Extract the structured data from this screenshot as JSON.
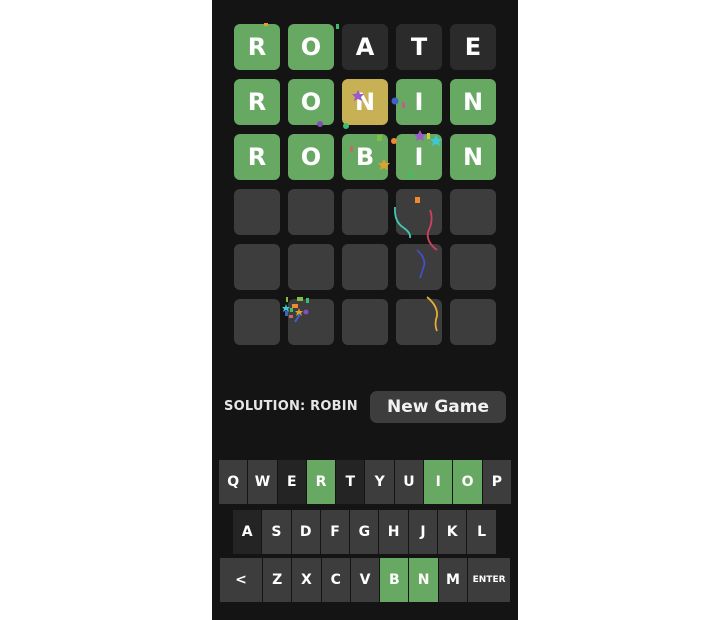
{
  "game": {
    "solution_text": "SOLUTION: ROBIN",
    "new_game_label": "New Game",
    "colors": {
      "correct": "#67a862",
      "present": "#c8b155",
      "absent": "#2b2b2b",
      "empty": "#3d3d3d",
      "background": "#141414"
    }
  },
  "board": {
    "rows": [
      {
        "tiles": [
          {
            "letter": "R",
            "state": "correct"
          },
          {
            "letter": "O",
            "state": "correct"
          },
          {
            "letter": "A",
            "state": "absent"
          },
          {
            "letter": "T",
            "state": "absent"
          },
          {
            "letter": "E",
            "state": "absent"
          }
        ]
      },
      {
        "tiles": [
          {
            "letter": "R",
            "state": "correct"
          },
          {
            "letter": "O",
            "state": "correct"
          },
          {
            "letter": "N",
            "state": "present"
          },
          {
            "letter": "I",
            "state": "correct"
          },
          {
            "letter": "N",
            "state": "correct"
          }
        ]
      },
      {
        "tiles": [
          {
            "letter": "R",
            "state": "correct"
          },
          {
            "letter": "O",
            "state": "correct"
          },
          {
            "letter": "B",
            "state": "correct"
          },
          {
            "letter": "I",
            "state": "correct"
          },
          {
            "letter": "N",
            "state": "correct"
          }
        ]
      },
      {
        "tiles": [
          {
            "letter": "",
            "state": "empty"
          },
          {
            "letter": "",
            "state": "empty"
          },
          {
            "letter": "",
            "state": "empty"
          },
          {
            "letter": "",
            "state": "empty"
          },
          {
            "letter": "",
            "state": "empty"
          }
        ]
      },
      {
        "tiles": [
          {
            "letter": "",
            "state": "empty"
          },
          {
            "letter": "",
            "state": "empty"
          },
          {
            "letter": "",
            "state": "empty"
          },
          {
            "letter": "",
            "state": "empty"
          },
          {
            "letter": "",
            "state": "empty"
          }
        ]
      },
      {
        "tiles": [
          {
            "letter": "",
            "state": "empty"
          },
          {
            "letter": "",
            "state": "empty"
          },
          {
            "letter": "",
            "state": "empty"
          },
          {
            "letter": "",
            "state": "empty"
          },
          {
            "letter": "",
            "state": "empty"
          }
        ]
      }
    ]
  },
  "keyboard": {
    "rows": [
      [
        {
          "label": "Q",
          "state": "unused"
        },
        {
          "label": "W",
          "state": "unused"
        },
        {
          "label": "E",
          "state": "absent"
        },
        {
          "label": "R",
          "state": "correct"
        },
        {
          "label": "T",
          "state": "absent"
        },
        {
          "label": "Y",
          "state": "unused"
        },
        {
          "label": "U",
          "state": "unused"
        },
        {
          "label": "I",
          "state": "correct"
        },
        {
          "label": "O",
          "state": "correct"
        },
        {
          "label": "P",
          "state": "unused"
        }
      ],
      [
        {
          "label": "A",
          "state": "absent"
        },
        {
          "label": "S",
          "state": "unused"
        },
        {
          "label": "D",
          "state": "unused"
        },
        {
          "label": "F",
          "state": "unused"
        },
        {
          "label": "G",
          "state": "unused"
        },
        {
          "label": "H",
          "state": "unused"
        },
        {
          "label": "J",
          "state": "unused"
        },
        {
          "label": "K",
          "state": "unused"
        },
        {
          "label": "L",
          "state": "unused"
        }
      ],
      [
        {
          "label": "<",
          "state": "unused",
          "kind": "backspace"
        },
        {
          "label": "Z",
          "state": "unused"
        },
        {
          "label": "X",
          "state": "unused"
        },
        {
          "label": "C",
          "state": "unused"
        },
        {
          "label": "V",
          "state": "unused"
        },
        {
          "label": "B",
          "state": "correct"
        },
        {
          "label": "N",
          "state": "correct"
        },
        {
          "label": "M",
          "state": "unused"
        },
        {
          "label": "ENTER",
          "state": "unused",
          "kind": "enter"
        }
      ]
    ]
  }
}
